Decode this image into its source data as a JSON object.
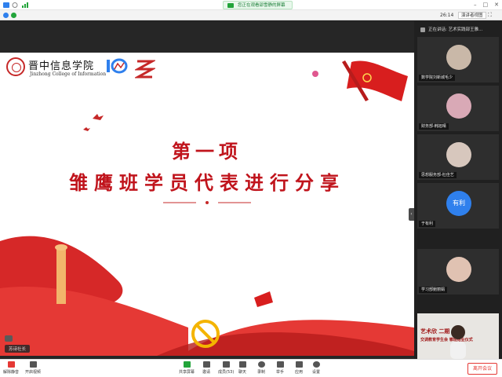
{
  "window": {
    "share_notice": "您正在观看邵雪静的屏幕"
  },
  "meeting_bar": {
    "timer": "26:14",
    "view_label": "演讲者视图"
  },
  "slide": {
    "school_name_cn": "晋中信息学院",
    "school_name_en": "Jinzhong College of Information",
    "title_line1": "第一项",
    "title_line2": "雏鹰班学员代表进行分享",
    "name_chip": "苏诗社长"
  },
  "panel": {
    "speaking_label": "正在讲话: 艺术实践部王雅...",
    "participants": [
      {
        "name": "数学院刘新城毛少"
      },
      {
        "name": "财务部-韩旭晴"
      },
      {
        "name": "思想服务部-杜佳艺"
      },
      {
        "name": "于有利",
        "initials": "有利"
      },
      {
        "name": "学习部鲍丽娟"
      }
    ],
    "video_tile": {
      "title": "艺术欣   二期",
      "subtitle": "交调教育学生会           雏班结业仪式"
    }
  },
  "toolbar": {
    "left_items": [
      {
        "label": "解除静音",
        "icon": "mic-icon"
      },
      {
        "label": "开启视频",
        "icon": "camera-icon"
      }
    ],
    "center_items": [
      {
        "label": "共享屏幕",
        "icon": "share-screen-icon"
      },
      {
        "label": "邀请",
        "icon": "invite-icon"
      },
      {
        "label": "成员(53)",
        "icon": "members-icon"
      },
      {
        "label": "聊天",
        "icon": "chat-icon"
      },
      {
        "label": "录制",
        "icon": "record-icon"
      },
      {
        "label": "举手",
        "icon": "hand-icon"
      },
      {
        "label": "应用",
        "icon": "apps-icon"
      },
      {
        "label": "设置",
        "icon": "settings-icon"
      }
    ],
    "leave_label": "离开会议"
  },
  "colors": {
    "accent_red": "#c0141c",
    "share_green": "#22a43a",
    "avatar_blue": "#2f80ed"
  }
}
